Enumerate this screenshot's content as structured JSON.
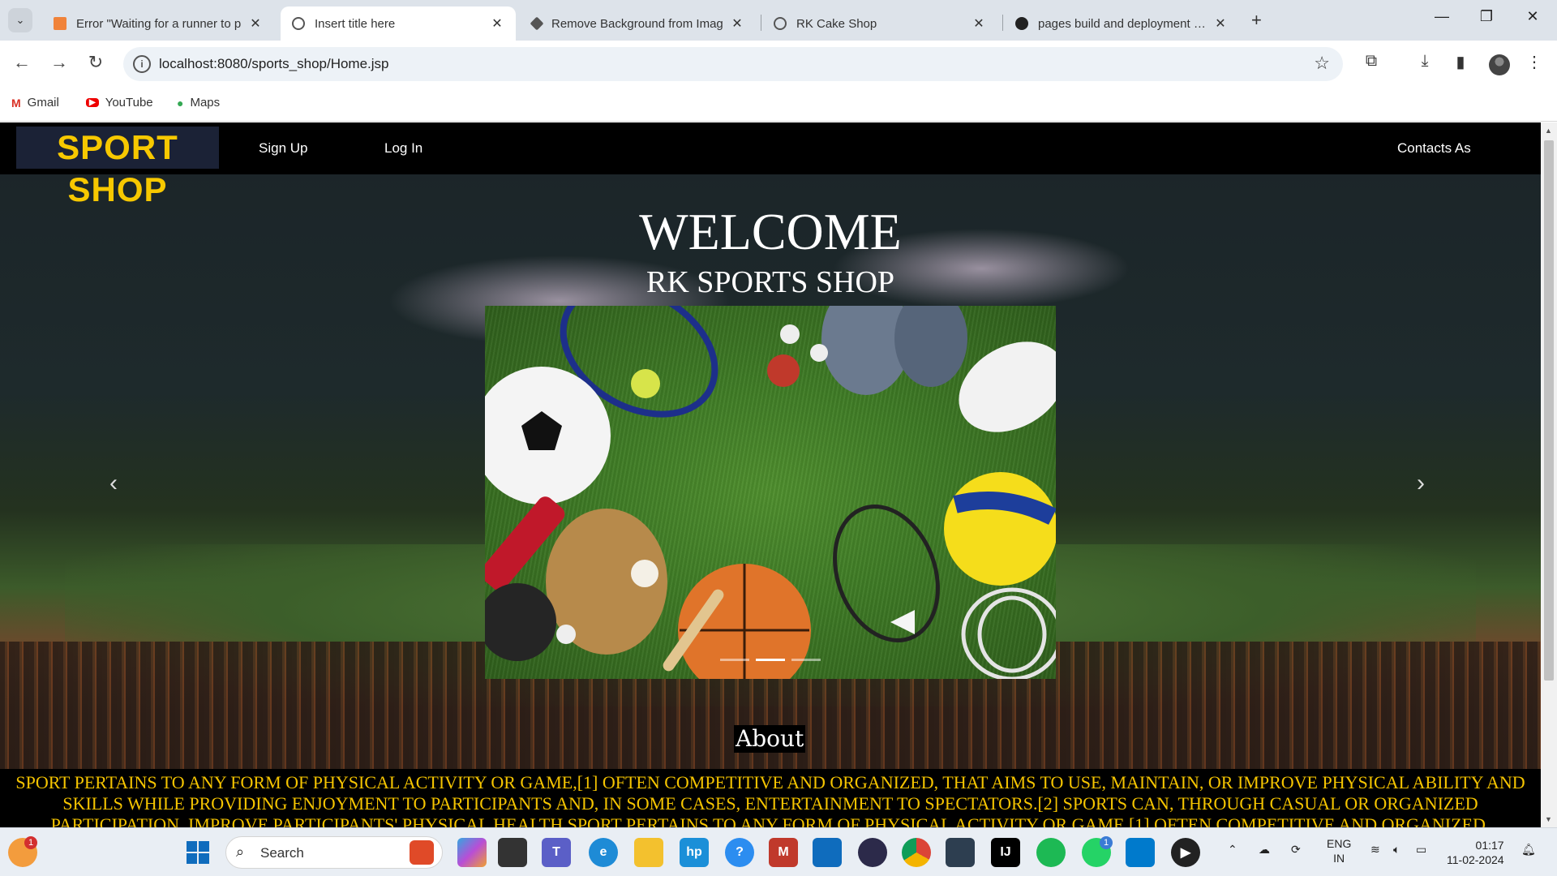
{
  "browser": {
    "tabs": [
      {
        "title": "Error \"Waiting for a runner to p",
        "active": false
      },
      {
        "title": "Insert title here",
        "active": true
      },
      {
        "title": "Remove Background from Imag",
        "active": false
      },
      {
        "title": "RK Cake Shop",
        "active": false
      },
      {
        "title": "pages build and deployment · &",
        "active": false
      }
    ],
    "url": "localhost:8080/sports_shop/Home.jsp",
    "bookmarks": [
      "Gmail",
      "YouTube",
      "Maps"
    ]
  },
  "navbar": {
    "logo": "SPORT SHOP",
    "links": [
      "Sign Up",
      "Log In"
    ],
    "right_link": "Contacts As"
  },
  "hero": {
    "welcome": "WELCOME",
    "shop_name": "RK SPORTS SHOP",
    "slide_count": 3,
    "active_slide": 2
  },
  "about": {
    "heading": "About",
    "text": "SPORT PERTAINS TO ANY FORM OF PHYSICAL ACTIVITY OR GAME,[1] OFTEN COMPETITIVE AND ORGANIZED, THAT AIMS TO USE, MAINTAIN, OR IMPROVE PHYSICAL ABILITY AND SKILLS WHILE PROVIDING ENJOYMENT TO PARTICIPANTS AND, IN SOME CASES, ENTERTAINMENT TO SPECTATORS.[2] SPORTS CAN, THROUGH CASUAL OR ORGANIZED PARTICIPATION, IMPROVE PARTICIPANTS' PHYSICAL HEALTH.SPORT PERTAINS TO ANY FORM OF PHYSICAL ACTIVITY OR GAME,[1] OFTEN COMPETITIVE AND ORGANIZED,"
  },
  "taskbar": {
    "search_placeholder": "Search",
    "notification_badge": "1",
    "whatsapp_badge": "1",
    "lang_line1": "ENG",
    "lang_line2": "IN",
    "time": "01:17",
    "date": "11-02-2024"
  },
  "colors": {
    "logo_text": "#f7c800",
    "about_text": "#f5c400",
    "navbar_bg": "#000000"
  }
}
